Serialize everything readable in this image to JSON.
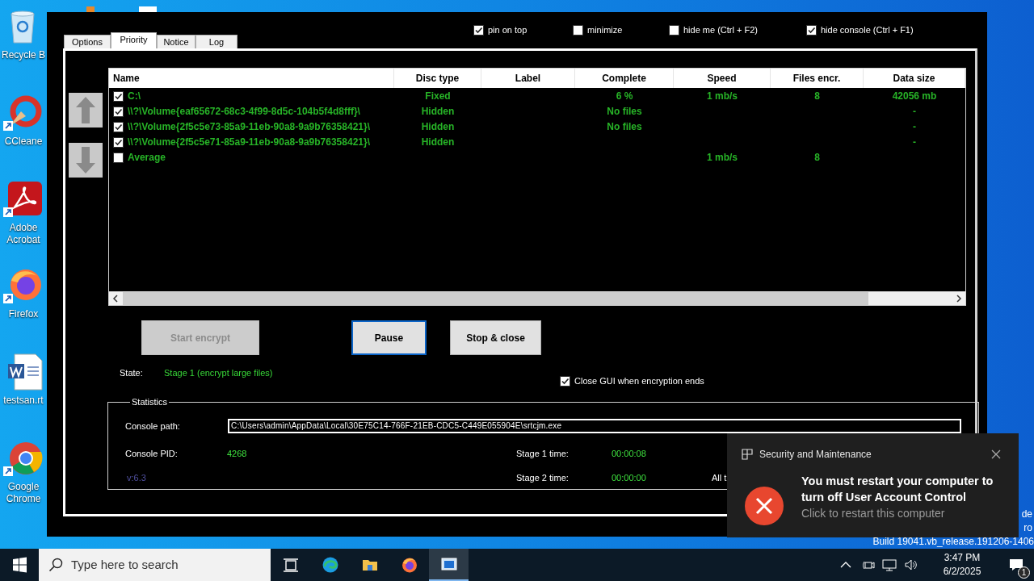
{
  "desktop": {
    "icons": [
      {
        "kind": "recycle",
        "label": "Recycle B"
      },
      {
        "kind": "ccleaner",
        "label": "CCleane"
      },
      {
        "kind": "acrobat",
        "label": "Adobe Acrobat"
      },
      {
        "kind": "firefox",
        "label": "Firefox"
      },
      {
        "kind": "word",
        "label": "testsan.rt"
      },
      {
        "kind": "chrome",
        "label": "Google Chrome"
      }
    ],
    "os_text": [
      "de",
      "ro",
      "Build 19041.vb_release.191206-1406"
    ]
  },
  "app": {
    "options": [
      {
        "label": "pin on top",
        "checked": true
      },
      {
        "label": "minimize",
        "checked": false
      },
      {
        "label": "hide me (Ctrl + F2)",
        "checked": false
      },
      {
        "label": "hide console (Ctrl + F1)",
        "checked": true
      }
    ],
    "tabs": [
      {
        "label": "Options",
        "selected": false
      },
      {
        "label": "Priority",
        "selected": true
      },
      {
        "label": "Notice",
        "selected": false
      },
      {
        "label": "Log",
        "selected": false
      }
    ],
    "table": {
      "columns": [
        "Name",
        "Disc type",
        "Label",
        "Complete",
        "Speed",
        "Files encr.",
        "Data size"
      ],
      "rows": [
        {
          "checked": true,
          "name": "C:\\",
          "disc_type": "Fixed",
          "complete": "6 %",
          "speed": "1 mb/s",
          "files_encr": "8",
          "data_size": "42056 mb"
        },
        {
          "checked": true,
          "name": "\\\\?\\Volume{eaf65672-68c3-4f99-8d5c-104b5f4d8fff}\\",
          "disc_type": "Hidden",
          "complete": "No files",
          "data_size": "-"
        },
        {
          "checked": true,
          "name": "\\\\?\\Volume{2f5c5e73-85a9-11eb-90a8-9a9b76358421}\\",
          "disc_type": "Hidden",
          "complete": "No files",
          "data_size": "-"
        },
        {
          "checked": true,
          "name": "\\\\?\\Volume{2f5c5e71-85a9-11eb-90a8-9a9b76358421}\\",
          "disc_type": "Hidden",
          "data_size": "-"
        },
        {
          "checked": false,
          "name": "Average",
          "speed": "1 mb/s",
          "files_encr": "8"
        }
      ]
    },
    "buttons": [
      {
        "label": "Start encrypt",
        "disabled": true,
        "focused": false
      },
      {
        "label": "Pause",
        "disabled": false,
        "focused": true
      },
      {
        "label": "Stop & close",
        "disabled": false,
        "focused": false
      }
    ],
    "state": {
      "label": "State:",
      "value": "Stage 1 (encrypt large files)"
    },
    "close_gui": {
      "label": "Close GUI when encryption ends",
      "checked": true
    },
    "statistics": {
      "title": "Statistics",
      "console_path_label": "Console path:",
      "console_path": "C:\\Users\\admin\\AppData\\Local\\30E75C14-766F-21EB-CDC5-C449E055904E\\srtcjm.exe",
      "pid_label": "Console PID:",
      "pid": "4268",
      "version": "v:6.3",
      "stage1_label": "Stage 1 time:",
      "stage1_time": "00:00:08",
      "stage2_label": "Stage 2 time:",
      "stage2_time": "00:00:00",
      "all_label": "All t"
    }
  },
  "notification": {
    "source": "Security and Maintenance",
    "title": "You must restart your computer to turn off User Account Control",
    "body": "Click to restart this computer"
  },
  "taskbar": {
    "search_placeholder": "Type here to search",
    "apps": [
      {
        "kind": "taskview",
        "selected": false
      },
      {
        "kind": "edge",
        "selected": false
      },
      {
        "kind": "explorer",
        "selected": false
      },
      {
        "kind": "firefox",
        "selected": false
      },
      {
        "kind": "window",
        "selected": true
      }
    ],
    "time": "3:47 PM",
    "date": "6/2/2025",
    "badge": "1"
  }
}
